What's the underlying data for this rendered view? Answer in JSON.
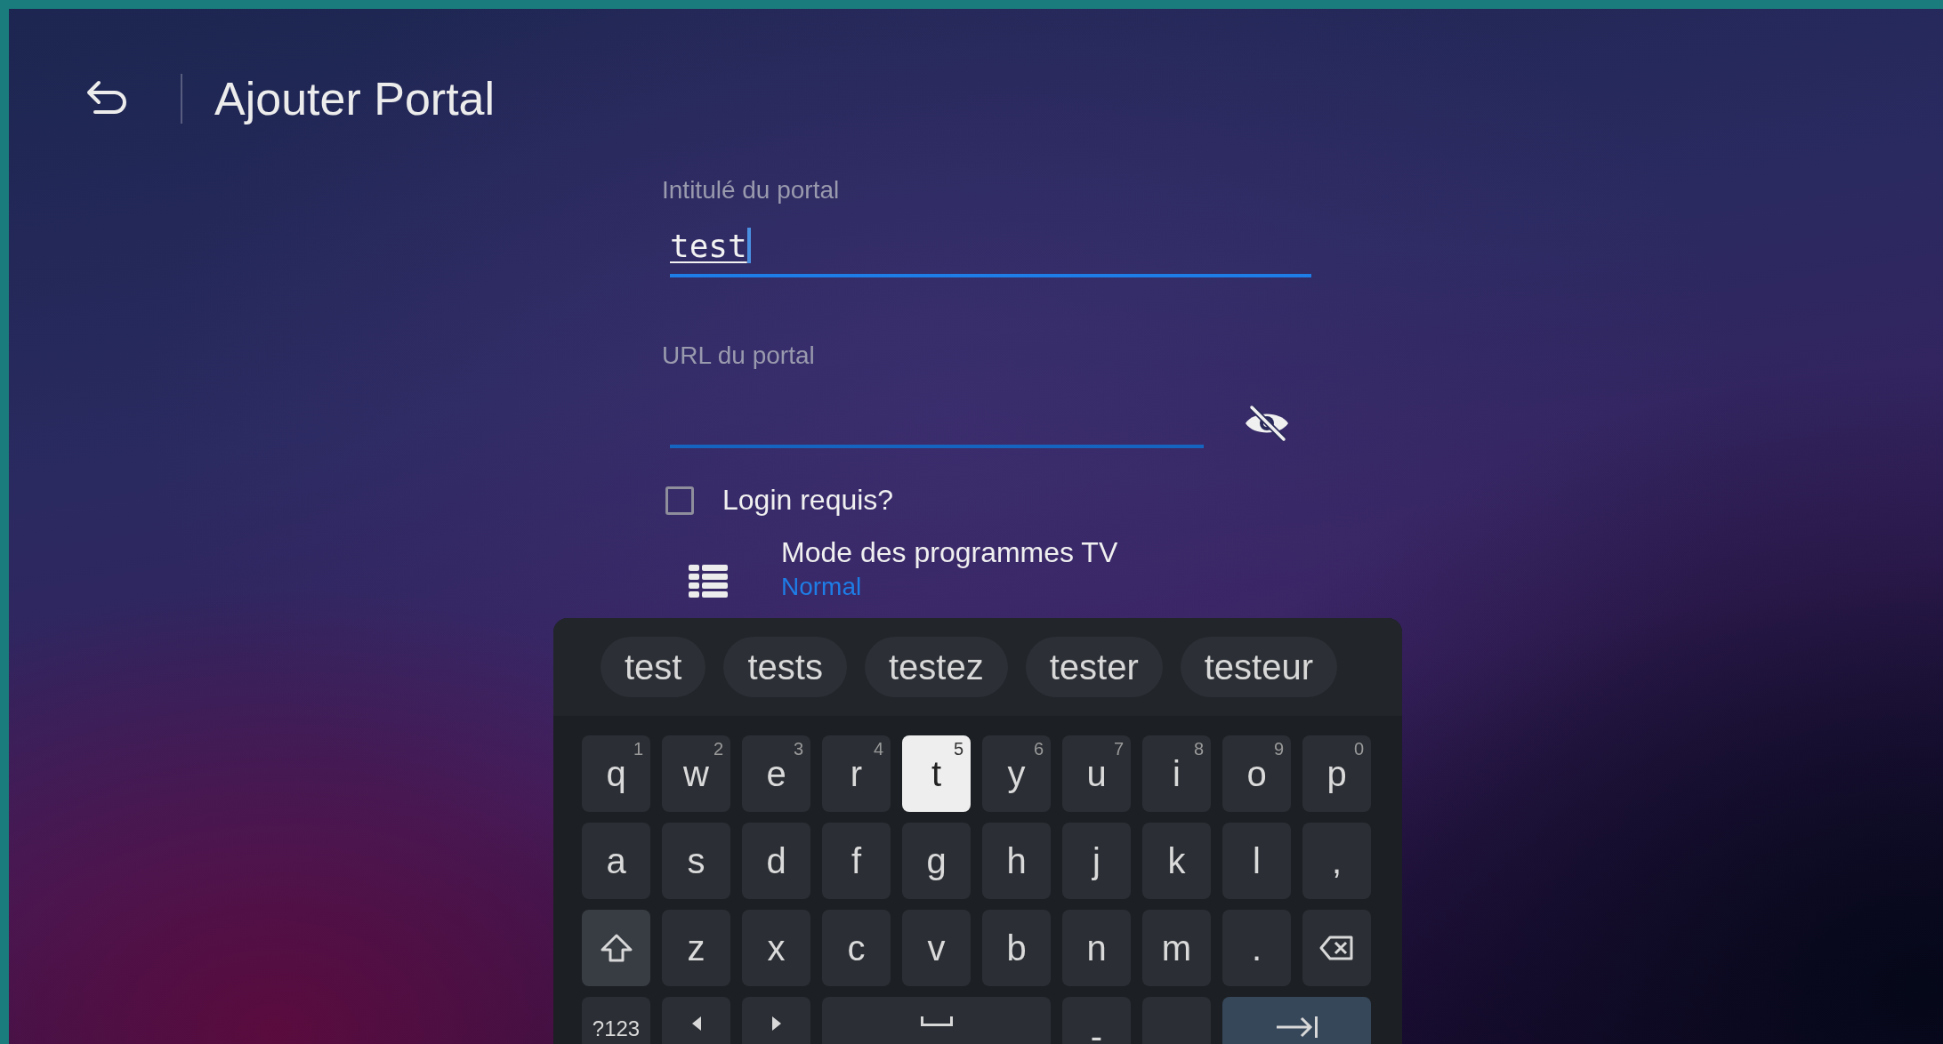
{
  "header": {
    "title": "Ajouter Portal"
  },
  "form": {
    "name_field": {
      "label": "Intitulé du portal",
      "value": "test",
      "focused": true
    },
    "url_field": {
      "label": "URL du portal",
      "password_hidden": true
    },
    "login_checkbox": {
      "label": "Login requis?",
      "checked": false
    },
    "guide_mode": {
      "title": "Mode des programmes TV",
      "value": "Normal"
    }
  },
  "keyboard": {
    "suggestions": [
      {
        "label": "test"
      },
      {
        "label": "tests"
      },
      {
        "label": "testez"
      },
      {
        "label": "tester"
      },
      {
        "label": "testeur"
      }
    ],
    "rows": [
      {
        "keys": [
          {
            "kind": "letter",
            "label": "q",
            "hint": "1",
            "selected": false
          },
          {
            "kind": "letter",
            "label": "w",
            "hint": "2",
            "selected": false
          },
          {
            "kind": "letter",
            "label": "e",
            "hint": "3",
            "selected": false
          },
          {
            "kind": "letter",
            "label": "r",
            "hint": "4",
            "selected": false
          },
          {
            "kind": "letter",
            "label": "t",
            "hint": "5",
            "selected": true
          },
          {
            "kind": "letter",
            "label": "y",
            "hint": "6",
            "selected": false
          },
          {
            "kind": "letter",
            "label": "u",
            "hint": "7",
            "selected": false
          },
          {
            "kind": "letter",
            "label": "i",
            "hint": "8",
            "selected": false
          },
          {
            "kind": "letter",
            "label": "o",
            "hint": "9",
            "selected": false
          },
          {
            "kind": "letter",
            "label": "p",
            "hint": "0",
            "selected": false
          }
        ]
      },
      {
        "keys": [
          {
            "kind": "letter",
            "label": "a",
            "selected": false
          },
          {
            "kind": "letter",
            "label": "s",
            "selected": false
          },
          {
            "kind": "letter",
            "label": "d",
            "selected": false
          },
          {
            "kind": "letter",
            "label": "f",
            "selected": false
          },
          {
            "kind": "letter",
            "label": "g",
            "selected": false
          },
          {
            "kind": "letter",
            "label": "h",
            "selected": false
          },
          {
            "kind": "letter",
            "label": "j",
            "selected": false
          },
          {
            "kind": "letter",
            "label": "k",
            "selected": false
          },
          {
            "kind": "letter",
            "label": "l",
            "selected": false
          },
          {
            "kind": "letter",
            "label": ",",
            "selected": false
          }
        ]
      },
      {
        "keys": [
          {
            "kind": "shift",
            "selected": false
          },
          {
            "kind": "letter",
            "label": "z",
            "selected": false
          },
          {
            "kind": "letter",
            "label": "x",
            "selected": false
          },
          {
            "kind": "letter",
            "label": "c",
            "selected": false
          },
          {
            "kind": "letter",
            "label": "v",
            "selected": false
          },
          {
            "kind": "letter",
            "label": "b",
            "selected": false
          },
          {
            "kind": "letter",
            "label": "n",
            "selected": false
          },
          {
            "kind": "letter",
            "label": "m",
            "selected": false
          },
          {
            "kind": "letter",
            "label": ".",
            "selected": false
          },
          {
            "kind": "backspace",
            "selected": false
          }
        ]
      },
      {
        "keys": [
          {
            "kind": "symbols",
            "label": "?123",
            "selected": false
          },
          {
            "kind": "left",
            "selected": false
          },
          {
            "kind": "right",
            "selected": false
          },
          {
            "kind": "space",
            "selected": false
          },
          {
            "kind": "letter",
            "label": "-",
            "selected": false
          },
          {
            "kind": "blank",
            "selected": false
          },
          {
            "kind": "tab",
            "selected": false
          }
        ]
      }
    ]
  }
}
